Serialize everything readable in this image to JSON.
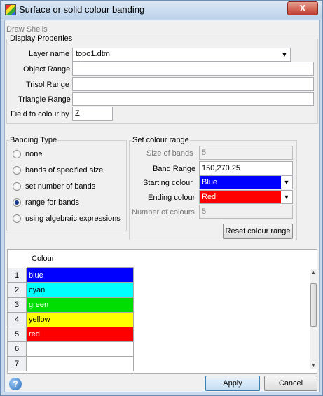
{
  "window": {
    "title": "Surface or solid colour banding",
    "close_label": "X"
  },
  "draw_shells_label": "Draw Shells",
  "display_properties": {
    "legend": "Display Properties",
    "layer_name_label": "Layer name",
    "layer_name_value": "topo1.dtm",
    "object_range_label": "Object Range",
    "object_range_value": "",
    "trisol_range_label": "Trisol Range",
    "trisol_range_value": "",
    "triangle_range_label": "Triangle Range",
    "triangle_range_value": "",
    "field_to_colour_label": "Field to colour by",
    "field_to_colour_value": "Z"
  },
  "banding_type": {
    "legend": "Banding Type",
    "options": [
      "none",
      "bands of specified size",
      "set number of bands",
      "range for bands",
      "using algebraic expressions"
    ],
    "selected": "range for bands"
  },
  "colour_range": {
    "legend": "Set colour range",
    "size_of_bands_label": "Size of bands",
    "size_of_bands_value": "5",
    "band_range_label": "Band Range",
    "band_range_value": "150,270,25",
    "starting_colour_label": "Starting colour",
    "starting_colour_value": "Blue",
    "starting_colour_hex": "#0000ff",
    "ending_colour_label": "Ending colour",
    "ending_colour_value": "Red",
    "ending_colour_hex": "#ff0000",
    "number_of_colours_label": "Number of colours",
    "number_of_colours_value": "5",
    "reset_label": "Reset colour range"
  },
  "table": {
    "column_header": "Colour",
    "rows": [
      {
        "num": "1",
        "name": "blue",
        "bg": "#0000ff",
        "fg": "#ffffff"
      },
      {
        "num": "2",
        "name": "cyan",
        "bg": "#00ffff",
        "fg": "#000000"
      },
      {
        "num": "3",
        "name": "green",
        "bg": "#00dd00",
        "fg": "#ffffff"
      },
      {
        "num": "4",
        "name": "yellow",
        "bg": "#ffff00",
        "fg": "#000000"
      },
      {
        "num": "5",
        "name": "red",
        "bg": "#ff0000",
        "fg": "#ffffff"
      },
      {
        "num": "6",
        "name": "",
        "bg": "#ffffff",
        "fg": "#000000"
      },
      {
        "num": "7",
        "name": "",
        "bg": "#ffffff",
        "fg": "#000000"
      }
    ]
  },
  "footer": {
    "help_label": "?",
    "apply_label": "Apply",
    "cancel_label": "Cancel"
  }
}
